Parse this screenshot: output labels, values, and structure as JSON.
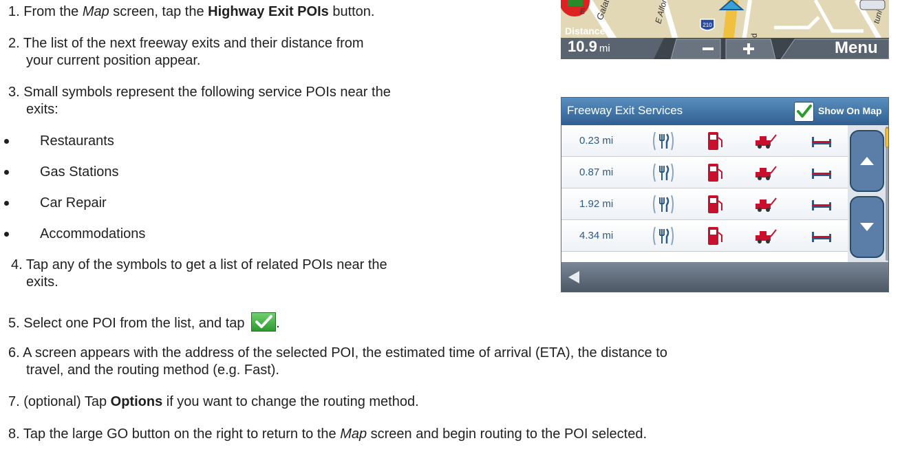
{
  "steps": [
    {
      "num": "1.",
      "parts": [
        {
          "t": "From the ",
          "s": "n"
        },
        {
          "t": "Map",
          "s": "i"
        },
        {
          "t": " screen, tap the ",
          "s": "n"
        },
        {
          "t": "Highway Exit POIs",
          "s": "b"
        },
        {
          "t": " button.",
          "s": "n"
        }
      ]
    },
    {
      "num": "2.",
      "line1": "The list of the next freeway exits and their distance from",
      "line2": "your current position appear."
    },
    {
      "num": "3.",
      "line1": "Small symbols represent the following service POIs near the",
      "line2": "exits:"
    },
    {
      "num": "4.",
      "line1": "Tap any of the symbols to get a list of related POIs near the",
      "line2": "exits."
    },
    {
      "num": "5.",
      "text": "Select one POI from the list, and tap"
    },
    {
      "num": "6.",
      "line1": "A screen appears with the address of the selected POI, the estimated time of arrival (ETA), the distance to",
      "line2": "travel, and the routing method (e.g. Fast)."
    },
    {
      "num": "7.",
      "parts": [
        {
          "t": "(optional) Tap ",
          "s": "n"
        },
        {
          "t": "Options",
          "s": "b"
        },
        {
          "t": " if you want to change the routing method.",
          "s": "n"
        }
      ]
    },
    {
      "num": "8.",
      "parts": [
        {
          "t": "Tap the large GO button on the right to return to the ",
          "s": "n"
        },
        {
          "t": "Map",
          "s": "i"
        },
        {
          "t": " screen and begin routing to the POI selected.",
          "s": "n"
        }
      ]
    }
  ],
  "bullets": [
    "Restaurants",
    "Gas Stations",
    "Car Repair",
    "Accommodations"
  ],
  "map_screen": {
    "distance_label": "Distance",
    "distance_value": "10.9",
    "distance_unit": "mi",
    "menu_label": "Menu",
    "route_shield": "210",
    "street_labels": [
      "Galatea",
      "E Alford S",
      "E",
      "d",
      "tuni"
    ]
  },
  "freeway_screen": {
    "title": "Freeway Exit Services",
    "show_on_map": "Show On Map",
    "rows": [
      {
        "distance": "0.23 mi"
      },
      {
        "distance": "0.87 mi"
      },
      {
        "distance": "1.92 mi"
      },
      {
        "distance": "4.34 mi"
      }
    ],
    "icons": [
      "restaurant-icon",
      "gas-station-icon",
      "car-repair-icon",
      "accommodation-icon"
    ]
  },
  "colors": {
    "header_blue": "#2f5f90",
    "check_green": "#2e9a2e",
    "distance_blue": "#2c5a86",
    "gas_red": "#c8102e"
  }
}
